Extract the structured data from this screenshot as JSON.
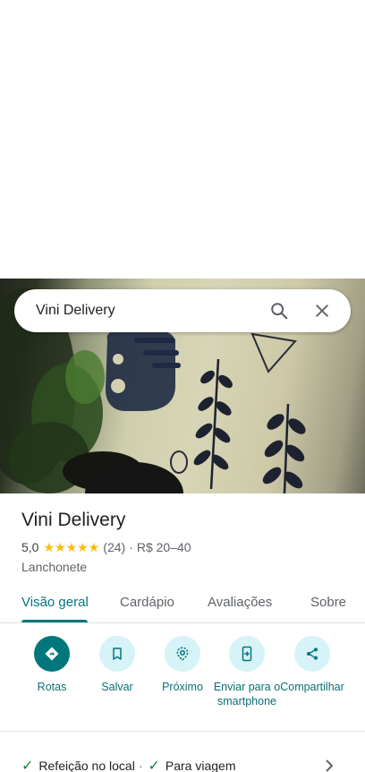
{
  "search": {
    "query": "Vini Delivery"
  },
  "place": {
    "name": "Vini Delivery",
    "rating": "5,0",
    "stars": 5,
    "reviews_count": "(24)",
    "separator": "·",
    "price": "R$ 20–40",
    "category": "Lanchonete"
  },
  "tabs": [
    {
      "label": "Visão geral",
      "active": true
    },
    {
      "label": "Cardápio",
      "active": false
    },
    {
      "label": "Avaliações",
      "active": false
    },
    {
      "label": "Sobre",
      "active": false
    }
  ],
  "actions": [
    {
      "label": "Rotas",
      "icon": "directions-icon"
    },
    {
      "label": "Salvar",
      "icon": "bookmark-icon"
    },
    {
      "label": "Próximo",
      "icon": "nearby-icon"
    },
    {
      "label": "Enviar para o smartphone",
      "icon": "send-to-phone-icon"
    },
    {
      "label": "Compartilhar",
      "icon": "share-icon"
    }
  ],
  "amenities": {
    "item1": "Refeição no local",
    "sep": "·",
    "item2": "Para viagem"
  },
  "colors": {
    "accent": "#00777b",
    "action_bg": "#d6f3f7",
    "star": "#fbbc04",
    "check": "#188038"
  }
}
